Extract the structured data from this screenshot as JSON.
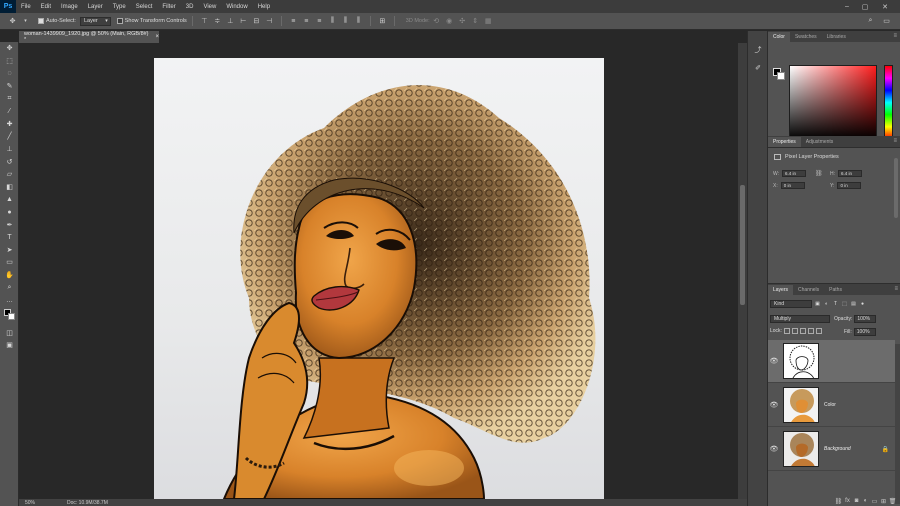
{
  "app": {
    "logo": "Ps"
  },
  "menu": [
    "File",
    "Edit",
    "Image",
    "Layer",
    "Type",
    "Select",
    "Filter",
    "3D",
    "View",
    "Window",
    "Help"
  ],
  "options": {
    "auto_select_label": "Auto-Select:",
    "auto_select_value": "Layer",
    "transform_label": "Show Transform Controls",
    "mode_3d_label": "3D Mode:"
  },
  "document": {
    "tab_title": "woman-1439909_1920.jpg @ 50% (Main, RGB/8#) *",
    "close_glyph": "×"
  },
  "status": {
    "zoom": "50%",
    "doc": "Doc: 10.9M/38.7M"
  },
  "panels": {
    "color_tabs": [
      "Color",
      "Swatches",
      "Libraries"
    ],
    "props_tabs": [
      "Properties",
      "Adjustments"
    ],
    "props_title": "Pixel Layer Properties",
    "w_label": "W:",
    "w_value": "6.4 in",
    "h_label": "H:",
    "h_value": "6.4 in",
    "x_label": "X:",
    "x_value": "0 in",
    "y_label": "Y:",
    "y_value": "0 in",
    "layers_tabs": [
      "Layers",
      "Channels",
      "Paths"
    ],
    "kind": "Kind",
    "blend_mode": "Multiply",
    "opacity_label": "Opacity:",
    "opacity_value": "100%",
    "lock_label": "Lock:",
    "fill_label": "Fill:",
    "fill_value": "100%"
  },
  "layers": [
    {
      "name": "",
      "selected": true,
      "type": "sketch"
    },
    {
      "name": "Color",
      "selected": false,
      "type": "color"
    },
    {
      "name": "Background",
      "selected": false,
      "type": "photo",
      "locked": true
    }
  ],
  "colors": {
    "accent": "#31a8ff",
    "panel": "#535353",
    "canvas_bg": "#282828"
  }
}
